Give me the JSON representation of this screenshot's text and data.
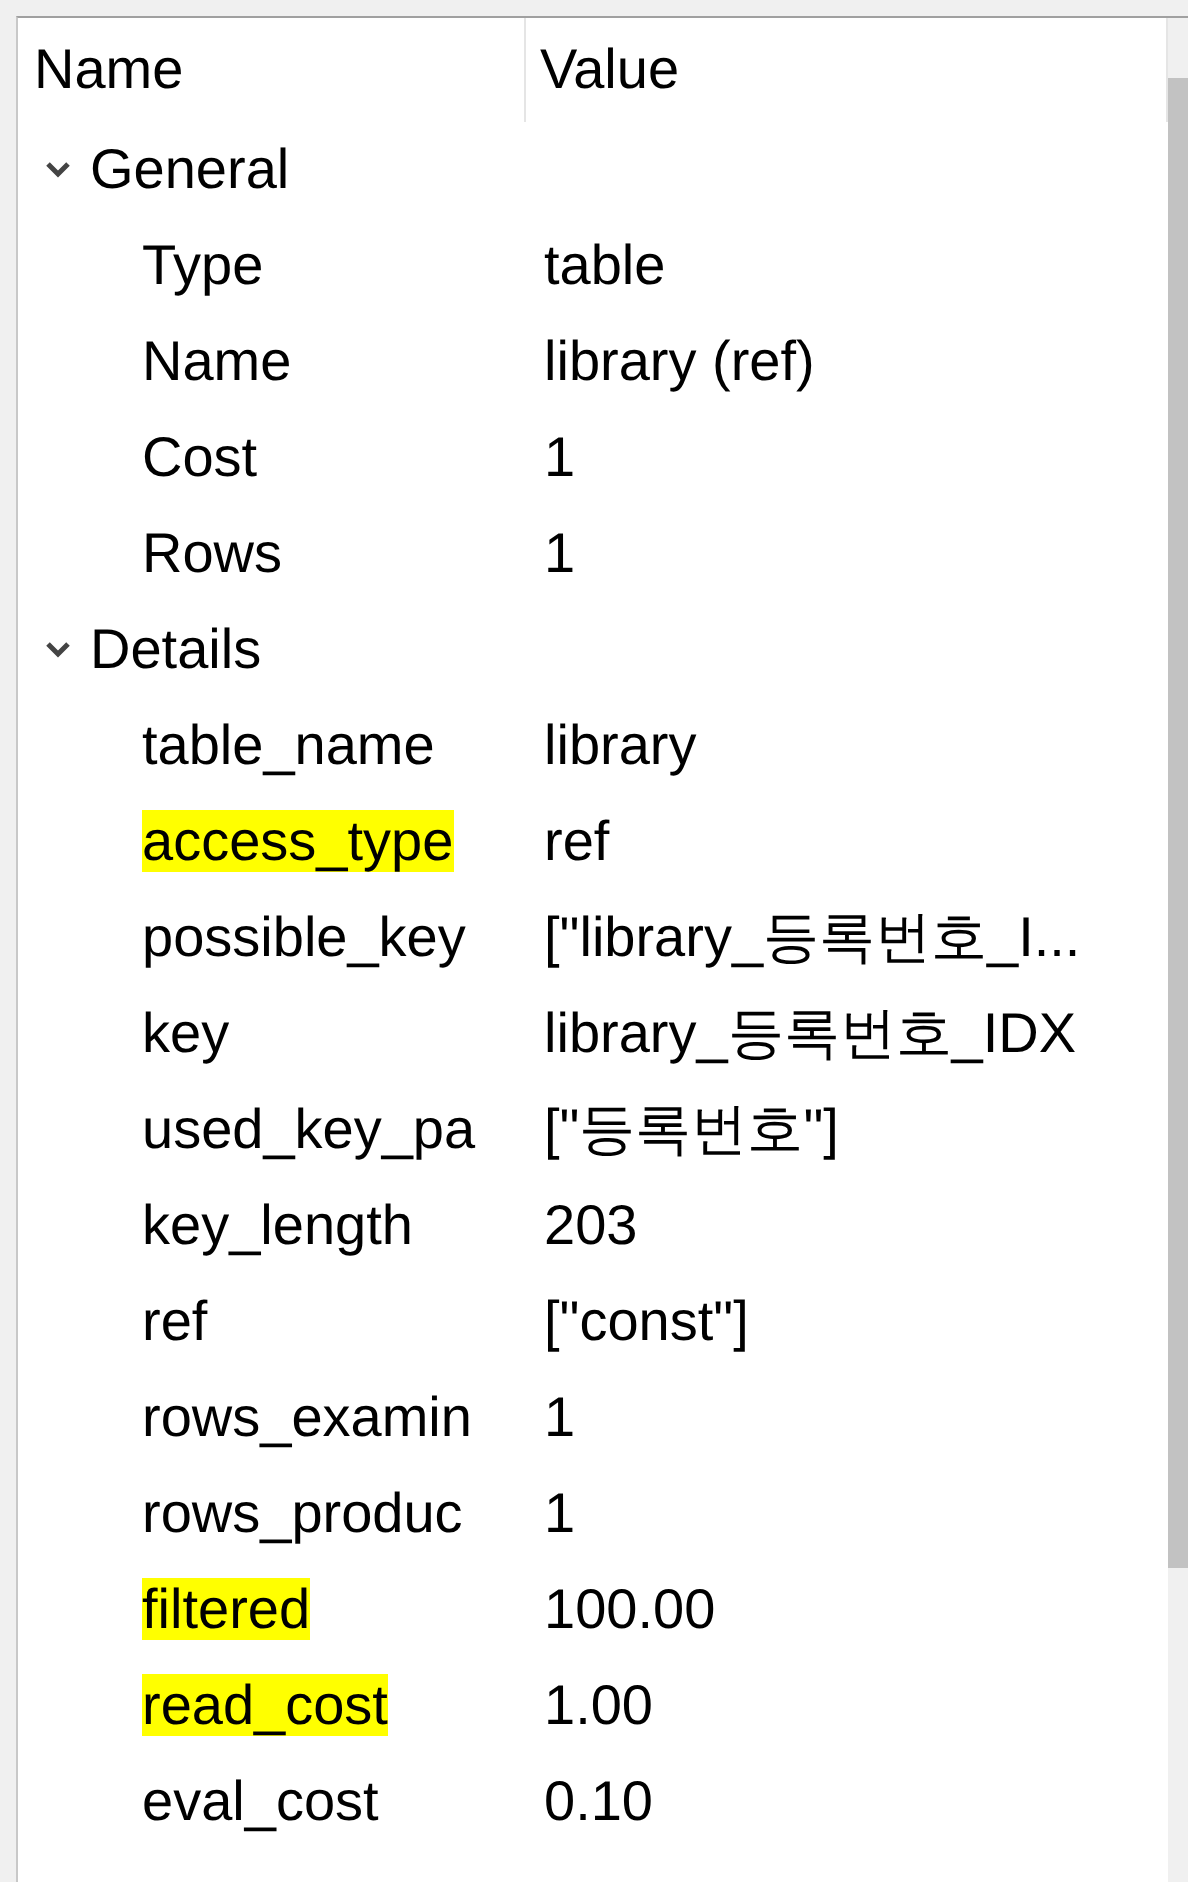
{
  "columns": [
    "Name",
    "Value"
  ],
  "groups": [
    {
      "label": "General",
      "expanded": true,
      "properties": [
        {
          "name": "Type",
          "value": "table",
          "highlighted": false
        },
        {
          "name": "Name",
          "value": "library (ref)",
          "highlighted": false
        },
        {
          "name": "Cost",
          "value": "1",
          "highlighted": false
        },
        {
          "name": "Rows",
          "value": "1",
          "highlighted": false
        }
      ]
    },
    {
      "label": "Details",
      "expanded": true,
      "properties": [
        {
          "name": "table_name",
          "value": "library",
          "highlighted": false
        },
        {
          "name": "access_type",
          "value": "ref",
          "highlighted": true
        },
        {
          "name": "possible_key",
          "value": "[\"library_등록번호_I...",
          "highlighted": false
        },
        {
          "name": "key",
          "value": "library_등록번호_IDX",
          "highlighted": false
        },
        {
          "name": "used_key_pa",
          "value": "[\"등록번호\"]",
          "highlighted": false
        },
        {
          "name": "key_length",
          "value": "203",
          "highlighted": false
        },
        {
          "name": "ref",
          "value": "[\"const\"]",
          "highlighted": false
        },
        {
          "name": "rows_examin",
          "value": "1",
          "highlighted": false
        },
        {
          "name": "rows_produc",
          "value": "1",
          "highlighted": false
        },
        {
          "name": "filtered",
          "value": "100.00",
          "highlighted": true
        },
        {
          "name": "read_cost",
          "value": "1.00",
          "highlighted": true
        },
        {
          "name": "eval_cost",
          "value": "0.10",
          "highlighted": false
        }
      ]
    }
  ]
}
